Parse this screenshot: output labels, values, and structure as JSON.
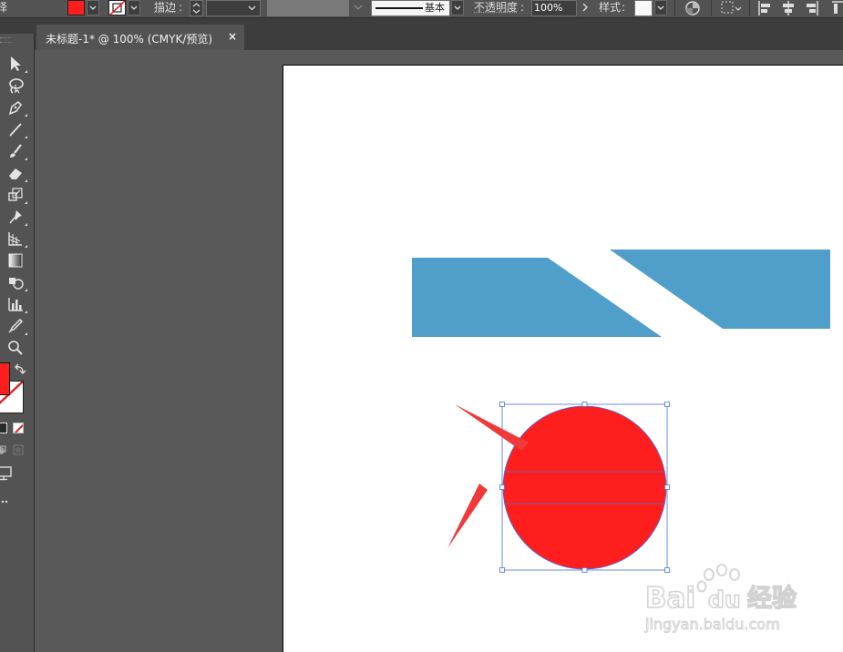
{
  "control_bar": {
    "left_clip_label": "择",
    "stroke_label": "描边",
    "brush_preset": "基本",
    "opacity_label": "不透明度",
    "opacity_value": "100%",
    "style_label": "样式"
  },
  "document_tab": {
    "title": "未标题-1* @ 100% (CMYK/预览)",
    "close_glyph": "×"
  },
  "tools": [
    {
      "name": "selection-tool-icon"
    },
    {
      "name": "lasso-tool-icon"
    },
    {
      "name": "pen-tool-icon"
    },
    {
      "name": "line-segment-tool-icon"
    },
    {
      "name": "paintbrush-tool-icon"
    },
    {
      "name": "eraser-tool-icon"
    },
    {
      "name": "scale-tool-icon"
    },
    {
      "name": "puppet-warp-tool-icon"
    },
    {
      "name": "perspective-grid-tool-icon"
    },
    {
      "name": "gradient-tool-icon"
    },
    {
      "name": "shape-builder-tool-icon"
    },
    {
      "name": "column-graph-tool-icon"
    },
    {
      "name": "eyedropper-tool-icon"
    },
    {
      "name": "zoom-tool-icon"
    }
  ],
  "colors": {
    "fill": "#ff1e1e",
    "blue_shape": "#4f9fca",
    "selection": "#4a6fe0",
    "arrow": "#f03a3a",
    "ui_bg": "#535353",
    "pasteboard": "#595959"
  },
  "watermark": {
    "brand_latin_1": "Bai",
    "brand_latin_2": "du",
    "brand_cn": "经验",
    "url": "jingyan.baidu.com"
  }
}
